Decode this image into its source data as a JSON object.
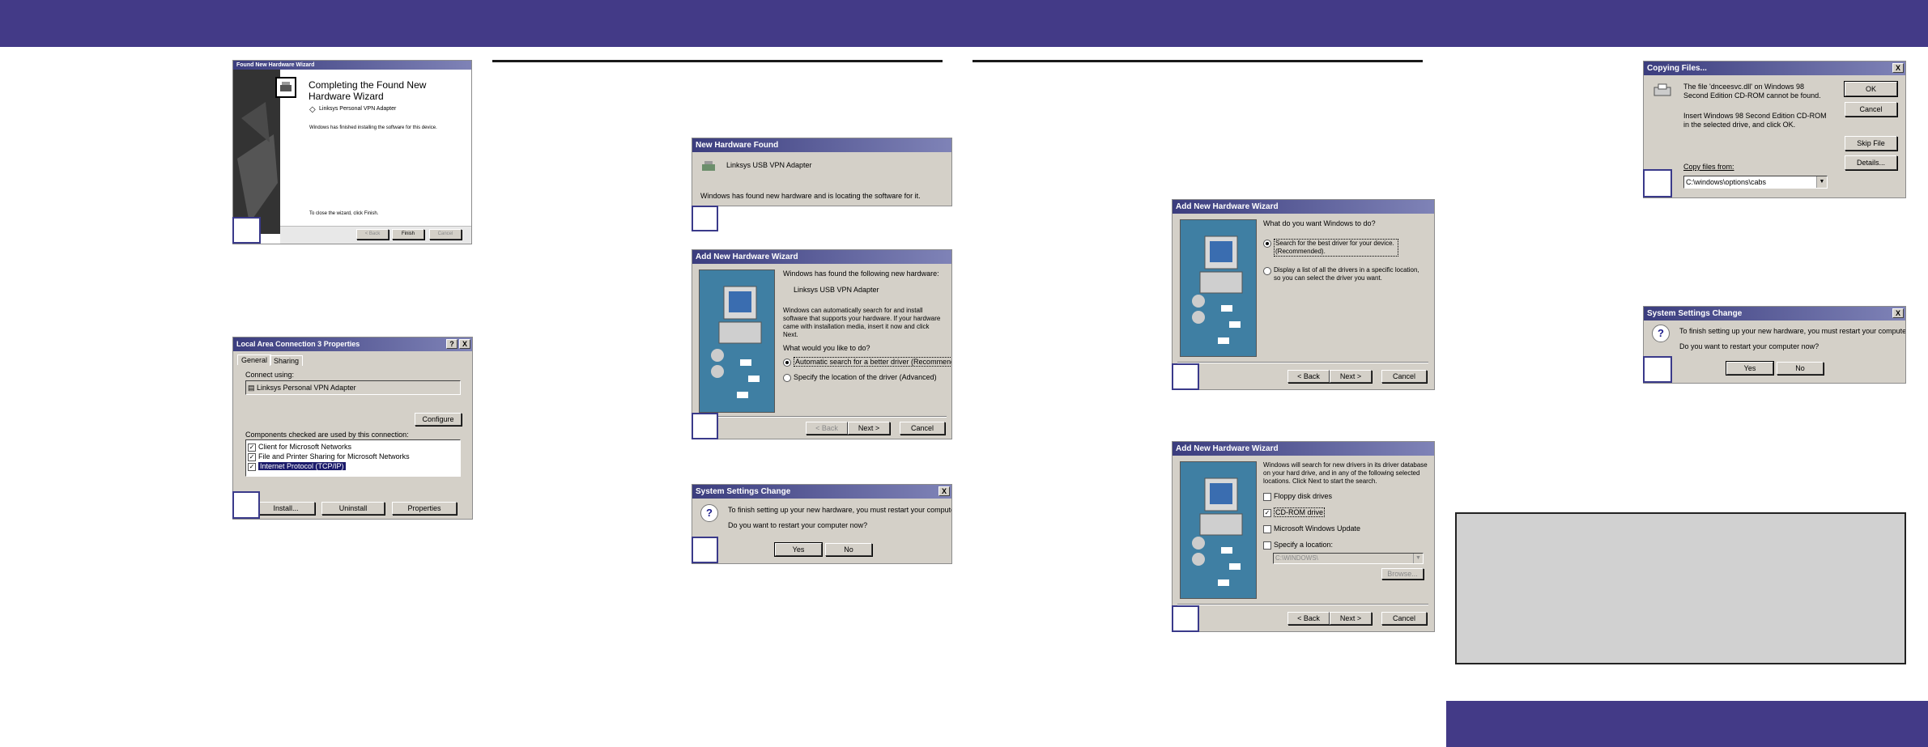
{
  "colors": {
    "bar": "#433a87",
    "title_bar": "#3b3d7e",
    "window": "#d4d0c8"
  },
  "w1": {
    "title": "Found New Hardware Wizard",
    "heading": "Completing the Found New Hardware Wizard",
    "device": "Linksys Personal VPN Adapter",
    "msg": "Windows has finished installing the software for this device.",
    "close_msg": "To close the wizard, click Finish.",
    "back": "< Back",
    "finish": "Finish",
    "cancel": "Cancel",
    "icon": "hardware-icon"
  },
  "w2": {
    "title": "Local Area Connection 3 Properties",
    "tab_general": "General",
    "tab_sharing": "Sharing",
    "connect_using": "Connect using:",
    "adapter": "Linksys Personal VPN Adapter",
    "configure": "Configure",
    "components_label": "Components checked are used by this connection:",
    "components": [
      "Client for Microsoft Networks",
      "File and Printer Sharing for Microsoft Networks",
      "Internet Protocol (TCP/IP)"
    ],
    "install": "Install...",
    "uninstall": "Uninstall",
    "properties": "Properties",
    "help": "?",
    "close": "X"
  },
  "w3": {
    "title": "New Hardware Found",
    "device": "Linksys USB VPN Adapter",
    "msg": "Windows has found new hardware and is locating the software for it."
  },
  "w4": {
    "title": "Add New Hardware Wizard",
    "found": "Windows has found the following new hardware:",
    "device": "Linksys USB VPN Adapter",
    "body": "Windows can automatically search for and install software that supports your hardware. If your hardware came with installation media, insert it now and click Next.",
    "question": "What would you like to do?",
    "opt1": "Automatic search for a better driver (Recommended)",
    "opt2": "Specify the location of the driver (Advanced)",
    "back": "< Back",
    "next": "Next >",
    "cancel": "Cancel"
  },
  "w5": {
    "title": "System Settings Change",
    "msg": "To finish setting up your new hardware, you must restart your computer.",
    "question": "Do you want to restart your computer now?",
    "yes": "Yes",
    "no": "No",
    "close": "X",
    "icon": "question-icon"
  },
  "w6": {
    "title": "Add New Hardware Wizard",
    "question": "What do you want Windows to do?",
    "opt1": "Search for the best driver for your device. (Recommended).",
    "opt2": "Display a list of all the drivers in a specific location, so you can select the driver you want.",
    "back": "< Back",
    "next": "Next >",
    "cancel": "Cancel"
  },
  "w7": {
    "title": "Add New Hardware Wizard",
    "body": "Windows will search for new drivers in its driver database on your hard drive, and in any of the following selected locations. Click Next to start the search.",
    "opt_floppy": "Floppy disk drives",
    "opt_cdrom": "CD-ROM drive",
    "opt_update": "Microsoft Windows Update",
    "opt_location": "Specify a location:",
    "location_value": "C:\\WINDOWS\\",
    "browse": "Browse...",
    "back": "< Back",
    "next": "Next >",
    "cancel": "Cancel"
  },
  "w8": {
    "title": "Copying Files...",
    "msg1": "The file 'dnceesvc.dll' on Windows 98 Second Edition CD-ROM cannot be found.",
    "msg2": "Insert Windows 98 Second Edition CD-ROM in the selected drive, and click OK.",
    "copy_from": "Copy files from:",
    "path": "C:\\windows\\options\\cabs",
    "ok": "OK",
    "cancel": "Cancel",
    "skip": "Skip File",
    "details": "Details...",
    "close": "X"
  },
  "w9": {
    "title": "System Settings Change",
    "msg": "To finish setting up your new hardware, you must restart your computer.",
    "question": "Do you want to restart your computer now?",
    "yes": "Yes",
    "no": "No",
    "close": "X"
  }
}
